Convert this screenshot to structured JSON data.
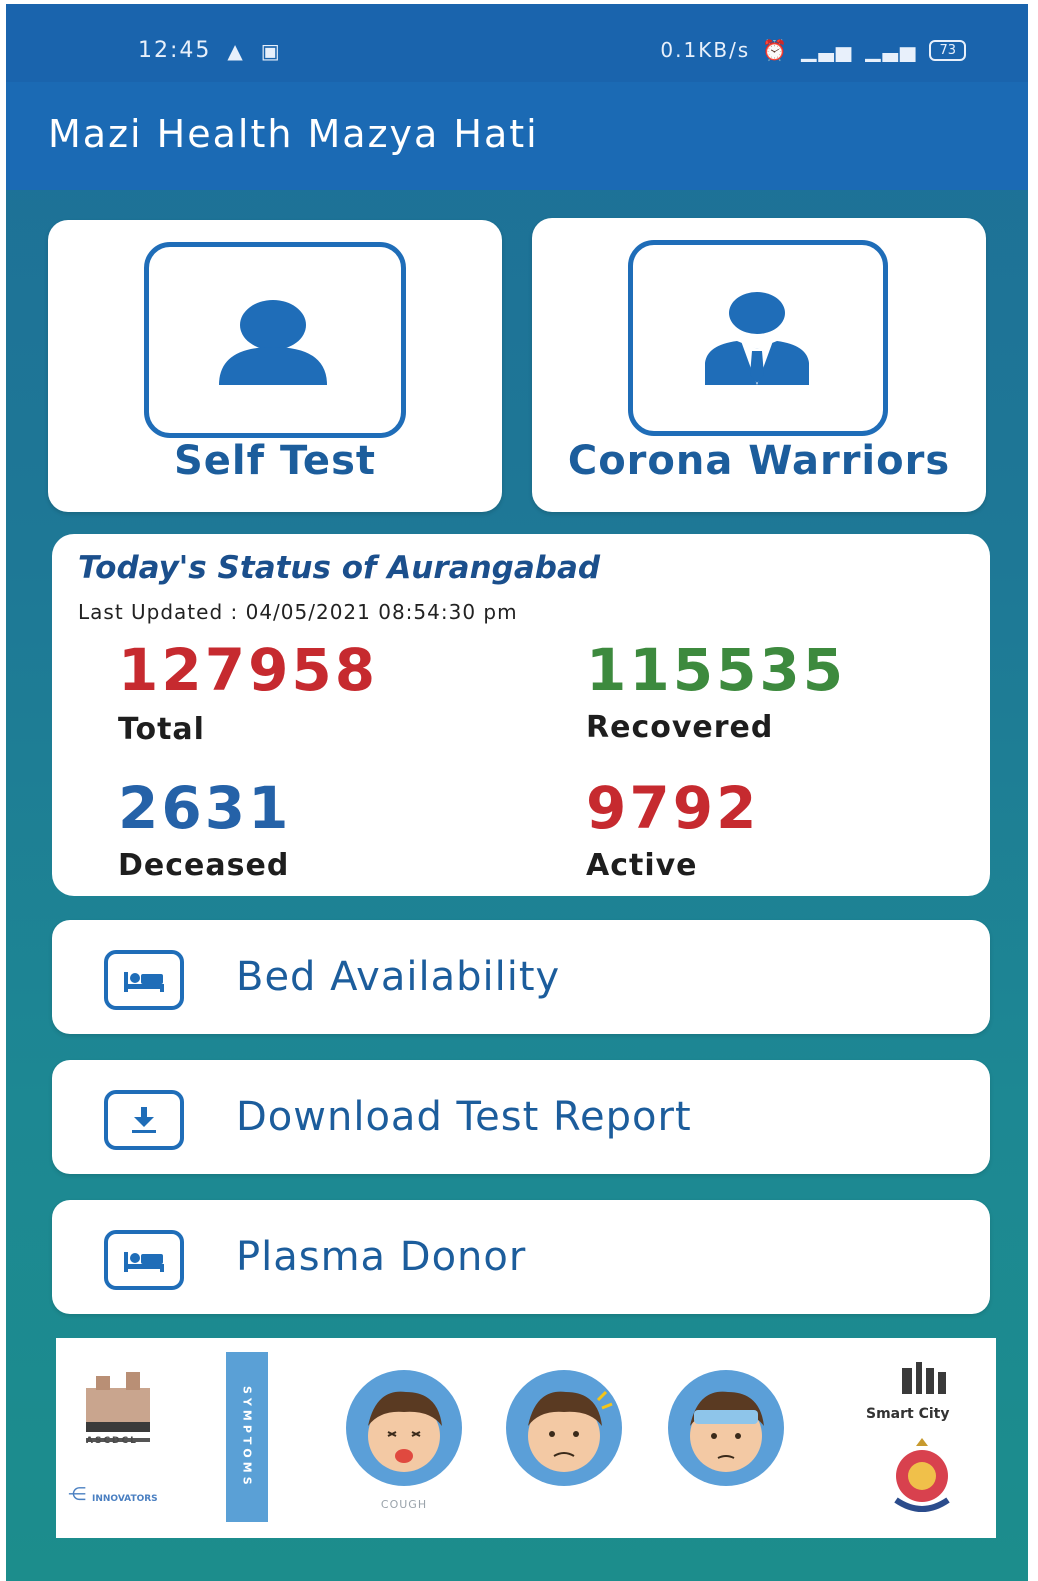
{
  "status_bar": {
    "time": "12:45",
    "left_icons": [
      "navigation-arrow-icon",
      "image-notification-icon"
    ],
    "network_speed": "0.1KB/s",
    "right_icons": [
      "alarm-icon",
      "signal-icon",
      "signal-hd-icon"
    ],
    "battery": "73"
  },
  "app_bar": {
    "title": "Mazi Health Mazya Hati"
  },
  "tiles": [
    {
      "label": "Self Test",
      "icon": "person-icon"
    },
    {
      "label": "Corona Warriors",
      "icon": "person-tie-icon"
    }
  ],
  "status": {
    "title": "Today's Status of Aurangabad",
    "last_updated": "Last Updated : 04/05/2021 08:54:30 pm",
    "stats": {
      "total": {
        "value": "127958",
        "label": "Total",
        "color": "#c62a2f"
      },
      "recovered": {
        "value": "115535",
        "label": "Recovered",
        "color": "#3d8a3e"
      },
      "deceased": {
        "value": "2631",
        "label": "Deceased",
        "color": "#2562a8"
      },
      "active": {
        "value": "9792",
        "label": "Active",
        "color": "#c62a2f"
      }
    }
  },
  "menu": [
    {
      "label": "Bed Availability",
      "icon": "bed-icon"
    },
    {
      "label": "Download Test Report",
      "icon": "download-icon"
    },
    {
      "label": "Plasma Donor",
      "icon": "bed-icon"
    }
  ],
  "footer": {
    "symptoms_label": "SYMPTOMS",
    "symptom_captions": [
      "COUGH",
      "",
      ""
    ],
    "smart_city": "Smart City",
    "left_logo_text": "ASCDCL",
    "innovators_text": "INNOVATORS"
  },
  "colors": {
    "app_bar": "#1b6ab4",
    "accent_blue": "#1c5d9c",
    "background_gradient_end": "#1c8d8c"
  }
}
